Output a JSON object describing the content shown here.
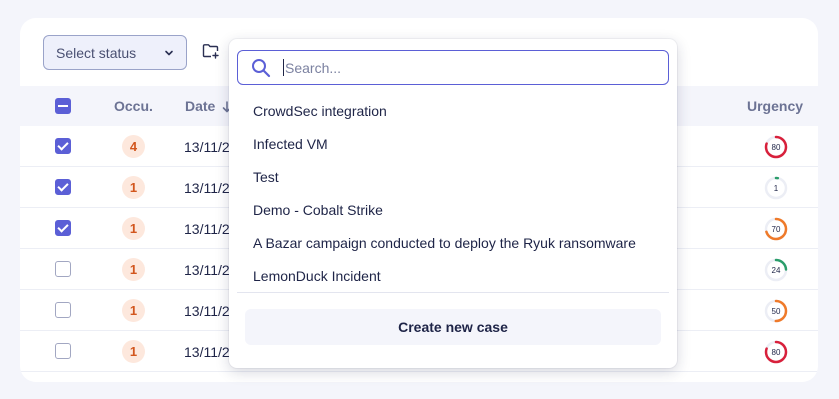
{
  "toolbar": {
    "status_placeholder": "Select status"
  },
  "table": {
    "headers": {
      "occurrences": "Occu.",
      "date": "Date",
      "urgency": "Urgency"
    },
    "rows": [
      {
        "checked": true,
        "occurrences": "4",
        "date": "13/11/2",
        "urgency": "80",
        "urgency_fraction": 0.8,
        "urgency_color": "#d8203b"
      },
      {
        "checked": true,
        "occurrences": "1",
        "date": "13/11/2",
        "urgency": "1",
        "urgency_fraction": 0.03,
        "urgency_color": "#2a9d6a"
      },
      {
        "checked": true,
        "occurrences": "1",
        "date": "13/11/2",
        "urgency": "70",
        "urgency_fraction": 0.7,
        "urgency_color": "#ef7a2a"
      },
      {
        "checked": false,
        "occurrences": "1",
        "date": "13/11/2",
        "urgency": "24",
        "urgency_fraction": 0.24,
        "urgency_color": "#2a9d6a"
      },
      {
        "checked": false,
        "occurrences": "1",
        "date": "13/11/2",
        "urgency": "50",
        "urgency_fraction": 0.5,
        "urgency_color": "#ef7a2a"
      },
      {
        "checked": false,
        "occurrences": "1",
        "date": "13/11/2",
        "urgency": "80",
        "urgency_fraction": 0.8,
        "urgency_color": "#d8203b"
      }
    ]
  },
  "dropdown": {
    "search_placeholder": "Search...",
    "search_value": "",
    "items": [
      "CrowdSec integration",
      "Infected VM",
      "Test",
      "Demo - Cobalt Strike",
      "A Bazar campaign conducted to deploy the Ryuk ransomware",
      "LemonDuck Incident"
    ],
    "create_label": "Create new case"
  },
  "icons": {
    "status_chevron": "chevron-down-icon",
    "folder": "folder-plus-icon",
    "sort": "arrow-down-icon",
    "search": "search-icon"
  },
  "colors": {
    "accent": "#5b5fd6",
    "occurrence_badge": "#fde8dd"
  }
}
